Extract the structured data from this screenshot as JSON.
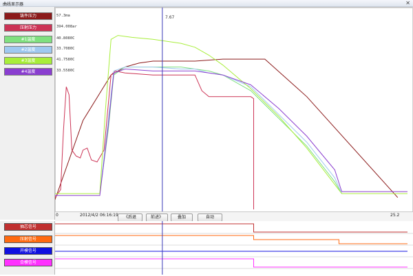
{
  "window": {
    "title": "曲线显示器",
    "close_glyph": "✕"
  },
  "legend": [
    {
      "label": "铸件压力",
      "color": "#8b1a1a",
      "reading": "57.3ma"
    },
    {
      "label": "压射压力",
      "color": "#cc3355",
      "reading": "394.008ar"
    },
    {
      "label": "#1温度",
      "color": "#7fe07f",
      "reading": "40.8080C"
    },
    {
      "label": "#2温度",
      "color": "#9fc9f0",
      "reading": "33.7080C"
    },
    {
      "label": "#3温度",
      "color": "#a8ee3a",
      "reading": "41.7580C"
    },
    {
      "label": "#4温度",
      "color": "#8a3ed0",
      "reading": "33.5580C"
    }
  ],
  "cursor": {
    "value_label": "7.67"
  },
  "toolbar": {
    "x_start": "0",
    "timestamp": "2012/4/2 06:16:19",
    "prev_button": "《后退",
    "next_button": "前进》",
    "overlay_button": "叠加",
    "auto_button": "自动",
    "x_end": "25.2"
  },
  "signals": [
    {
      "label": "抽芯信号",
      "color": "#c03030"
    },
    {
      "label": "压射信号",
      "color": "#ff6a10"
    },
    {
      "label": "开模信号",
      "color": "#1010e0"
    },
    {
      "label": "合模信号",
      "color": "#ff30ff"
    }
  ],
  "chart_data": {
    "type": "line",
    "xlim": [
      0,
      25.2
    ],
    "ylim": [
      0,
      100
    ],
    "cursor_x": 7.67,
    "series": [
      {
        "name": "铸件压力",
        "color": "#8b1a1a",
        "x": [
          0,
          2,
          4,
          5,
          6,
          7,
          8,
          10,
          12,
          14,
          15,
          18,
          24.5
        ],
        "y": [
          5,
          45,
          68,
          72,
          74,
          75,
          75,
          75,
          76,
          76,
          76,
          57,
          6
        ]
      },
      {
        "name": "压射压力",
        "color": "#cc3355",
        "x": [
          0,
          0.4,
          0.6,
          0.8,
          1.0,
          1.2,
          1.5,
          1.8,
          2.0,
          2.3,
          2.6,
          3.0,
          3.5,
          4.0,
          4.3,
          5.0,
          7.0,
          9.0,
          10.0,
          10.5,
          11.0,
          14.0,
          14.2,
          14.2
        ],
        "y": [
          6,
          10,
          40,
          62,
          58,
          30,
          27,
          26,
          30,
          31,
          25,
          24,
          30,
          68,
          70,
          69,
          68,
          68,
          68,
          60,
          57,
          57,
          56,
          0
        ]
      },
      {
        "name": "#1温度",
        "color": "#7fe07f",
        "x": [
          0,
          3.2,
          3.8,
          4.2,
          5,
          7,
          9,
          10,
          11,
          12,
          14,
          16,
          18,
          20,
          20.5,
          25.2
        ],
        "y": [
          8,
          8,
          40,
          68,
          72,
          72,
          72,
          71,
          70,
          68,
          60,
          46,
          32,
          14,
          8,
          8
        ]
      },
      {
        "name": "#2温度",
        "color": "#9fc9f0",
        "x": [
          0,
          3.2,
          3.8,
          4.2,
          5,
          7,
          9,
          10,
          11,
          12,
          14,
          16,
          18,
          20,
          20.5,
          25.2
        ],
        "y": [
          8,
          8,
          45,
          70,
          72,
          72,
          71,
          71,
          69,
          68,
          62,
          48,
          34,
          16,
          8,
          8
        ]
      },
      {
        "name": "#3温度",
        "color": "#a8ee3a",
        "x": [
          0,
          3.2,
          3.6,
          4.0,
          4.5,
          5.5,
          7,
          9,
          10,
          11,
          12,
          14,
          16,
          18,
          20.5,
          25.2
        ],
        "y": [
          8,
          8,
          50,
          86,
          88,
          87,
          86,
          84,
          82,
          78,
          73,
          61,
          47,
          31,
          8,
          8
        ]
      },
      {
        "name": "#4温度",
        "color": "#8a3ed0",
        "x": [
          0,
          3.2,
          3.8,
          4.2,
          5,
          7,
          9,
          10,
          11,
          12,
          14,
          16,
          18,
          20,
          20.5,
          25.2
        ],
        "y": [
          7,
          7,
          42,
          69,
          71,
          70,
          70,
          70,
          69,
          68,
          63,
          51,
          37,
          20,
          9,
          9
        ]
      }
    ],
    "digital": [
      {
        "name": "抽芯信号",
        "color": "#c03030",
        "x": [
          0,
          14.2,
          25.2
        ],
        "levels": [
          1,
          0
        ]
      },
      {
        "name": "压射信号",
        "color": "#ff6a10",
        "x": [
          0,
          14.2,
          20.3,
          25.2
        ],
        "levels": [
          1,
          0.5,
          0
        ]
      },
      {
        "name": "开模信号",
        "color": "#1010e0",
        "x": [
          0,
          25.2
        ],
        "levels": [
          0.5
        ]
      },
      {
        "name": "合模信号",
        "color": "#ff30ff",
        "x": [
          0,
          14.2,
          25.2
        ],
        "levels": [
          1,
          0
        ]
      }
    ]
  }
}
